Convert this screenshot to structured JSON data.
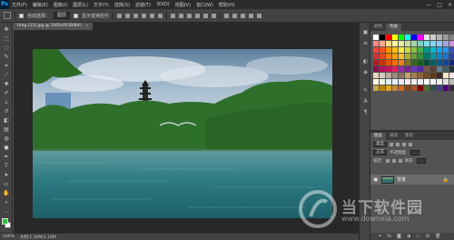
{
  "app": {
    "logo": "Ps"
  },
  "menu": [
    "文件(F)",
    "编辑(E)",
    "图像(I)",
    "图层(L)",
    "文字(Y)",
    "选择(S)",
    "滤镜(T)",
    "3D(D)",
    "视图(V)",
    "窗口(W)",
    "帮助(H)"
  ],
  "window_controls": [
    "—",
    "□",
    "✕"
  ],
  "options": {
    "auto_select_label": "自动选择：",
    "auto_select_value": "图层",
    "transform_label": "显示变换控件"
  },
  "document": {
    "tab_title": "timg (13).jpg @ 100%(RGB/8#)",
    "close_glyph": "×"
  },
  "status": {
    "zoom": "100%",
    "doc_info": "文档:1.16M/1.16M"
  },
  "panels": {
    "top_tabs": [
      "颜色",
      "色板"
    ],
    "layer_tabs": [
      "图层",
      "通道",
      "路径"
    ],
    "kind_label": "类型",
    "blend_mode": "正常",
    "opacity_label": "不透明度:",
    "lock_label": "锁定:",
    "fill_label": "填充:"
  },
  "layers": [
    {
      "name": "背景",
      "lock": "🔒"
    }
  ],
  "watermark": {
    "text": "当下软件园",
    "url": "www.downxia.com"
  },
  "swatch_colors": [
    "#ffffff",
    "#000000",
    "#ff0000",
    "#ffff00",
    "#00ff00",
    "#00ffff",
    "#0000ff",
    "#ff00ff",
    "#e6e6e6",
    "#cccccc",
    "#b3b3b3",
    "#999999",
    "#808080",
    "#ff8a80",
    "#ffab91",
    "#ffe082",
    "#fff59d",
    "#e6ee9c",
    "#c5e1a5",
    "#a5d6a7",
    "#80cbc4",
    "#80deea",
    "#81d4fa",
    "#90caf9",
    "#9fa8da",
    "#ce93d8",
    "#f44336",
    "#ff5722",
    "#ff9800",
    "#ffc107",
    "#ffeb3b",
    "#cddc39",
    "#8bc34a",
    "#4caf50",
    "#009688",
    "#00bcd4",
    "#03a9f4",
    "#2196f3",
    "#3f51b5",
    "#d32f2f",
    "#e64a19",
    "#f57c00",
    "#ffa000",
    "#fbc02d",
    "#afb42b",
    "#689f38",
    "#388e3c",
    "#00796b",
    "#0097a7",
    "#0288d1",
    "#1976d2",
    "#303f9f",
    "#b71c1c",
    "#bf360c",
    "#e65100",
    "#ff6f00",
    "#f57f17",
    "#827717",
    "#33691e",
    "#1b5e20",
    "#004d40",
    "#006064",
    "#01579b",
    "#0d47a1",
    "#1a237e",
    "#880e4f",
    "#ad1457",
    "#c2185b",
    "#e91e63",
    "#9c27b0",
    "#7b1fa2",
    "#673ab7",
    "#512da8",
    "#795548",
    "#5d4037",
    "#607d8b",
    "#455a64",
    "#263238",
    "#e8d5b7",
    "#d7ccc8",
    "#bcaaa4",
    "#a1887f",
    "#8d6e63",
    "#c8a165",
    "#a67c52",
    "#8c6239",
    "#754c24",
    "#603913",
    "#3e2723",
    "#f5e6c8",
    "#fce4ec",
    "#fff8e1",
    "#f1f8e9",
    "#e0f2f1",
    "#e3f2fd",
    "#ede7f6",
    "#fbe9e7",
    "#efebe9",
    "#eceff1",
    "#fafafa",
    "#f5f5f5",
    "#eeeeee",
    "#e0e0e0",
    "#bdbdbd",
    "#c6a84b",
    "#b8860b",
    "#daa520",
    "#cd853f",
    "#d2691e",
    "#8b4513",
    "#a0522d",
    "#800000",
    "#556b2f",
    "#2f4f4f",
    "#483d8b",
    "#4b0082",
    "#2e2e2e"
  ]
}
